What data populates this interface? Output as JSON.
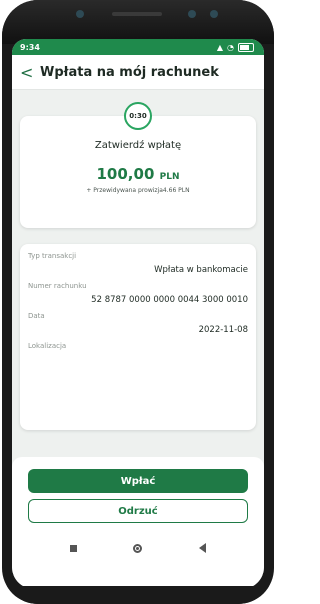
{
  "status": {
    "time": "9:34"
  },
  "header": {
    "back_icon": "chevron-left-icon",
    "title": "Wpłata na mój rachunek"
  },
  "timer": {
    "value": "0:30"
  },
  "confirm": {
    "title": "Zatwierdź wpłatę",
    "amount_main": "100,00",
    "amount_currency": "PLN",
    "commission": "+ Przewidywana prowizja4.66 PLN"
  },
  "details": {
    "transaction_type_label": "Typ transakcji",
    "transaction_type_value": "Wpłata w bankomacie",
    "account_label": "Numer rachunku",
    "account_value": "52 8787 0000 0000 0044 3000 0010",
    "date_label": "Data",
    "date_value": "2022-11-08",
    "location_label": "Lokalizacja"
  },
  "actions": {
    "primary": "Wpłać",
    "secondary": "Odrzuć"
  },
  "colors": {
    "brand_green": "#1f7a46",
    "status_green": "#1f8a4c"
  }
}
